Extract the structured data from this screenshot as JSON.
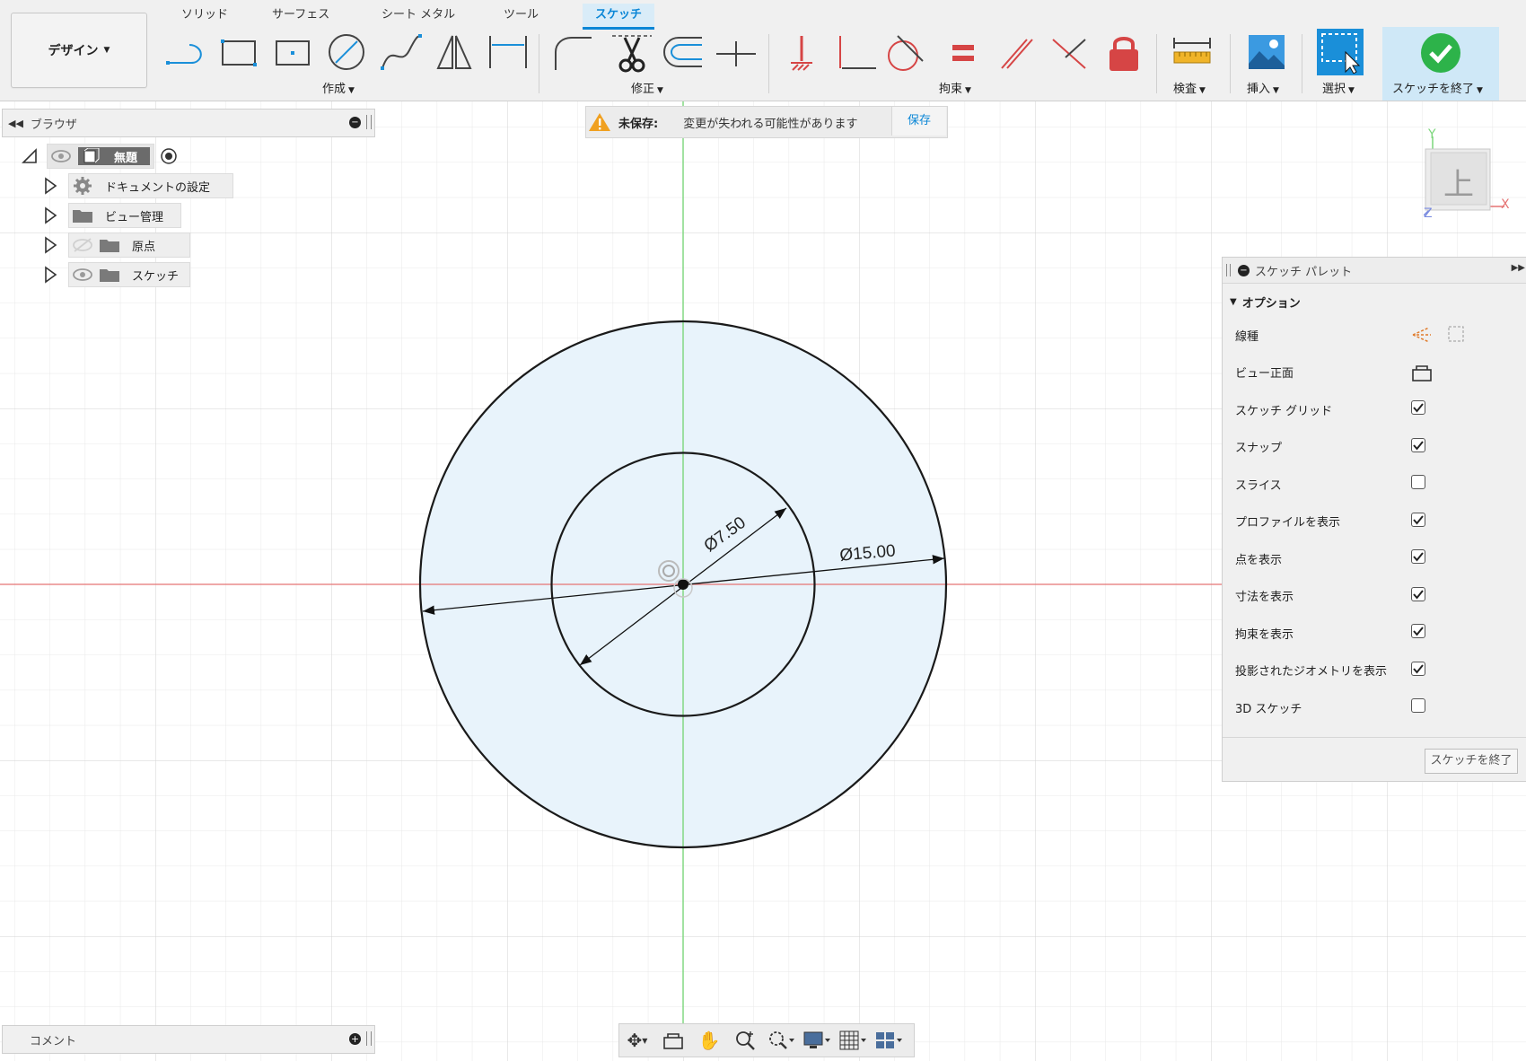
{
  "toolbar": {
    "workspace": "デザイン",
    "tabs": [
      "ソリッド",
      "サーフェス",
      "シート メタル",
      "ツール",
      "スケッチ"
    ],
    "active_tab": "スケッチ",
    "groups": {
      "create": "作成",
      "modify": "修正",
      "constraints": "拘束",
      "inspect": "検査",
      "insert": "挿入",
      "select": "選択",
      "finish": "スケッチを終了"
    }
  },
  "browser": {
    "title": "ブラウザ",
    "root": "無題",
    "items": [
      "ドキュメントの設定",
      "ビュー管理",
      "原点",
      "スケッチ"
    ]
  },
  "unsaved": {
    "label": "未保存:",
    "message": "変更が失われる可能性があります",
    "save": "保存"
  },
  "palette": {
    "title": "スケッチ パレット",
    "section": "オプション",
    "rows": [
      {
        "label": "線種",
        "control": "linetype"
      },
      {
        "label": "ビュー正面",
        "control": "view"
      },
      {
        "label": "スケッチ グリッド",
        "checked": true
      },
      {
        "label": "スナップ",
        "checked": true
      },
      {
        "label": "スライス",
        "checked": false
      },
      {
        "label": "プロファイルを表示",
        "checked": true
      },
      {
        "label": "点を表示",
        "checked": true
      },
      {
        "label": "寸法を表示",
        "checked": true
      },
      {
        "label": "拘束を表示",
        "checked": true
      },
      {
        "label": "投影されたジオメトリを表示",
        "checked": true
      },
      {
        "label": "3D スケッチ",
        "checked": false
      }
    ],
    "finish_button": "スケッチを終了"
  },
  "canvas": {
    "dimension_inner": "Ø7.50",
    "dimension_outer": "Ø15.00",
    "axis_colors": {
      "x": "#e57373",
      "y": "#7bd67b",
      "profile_fill": "#e8f3fb"
    }
  },
  "viewcube": {
    "face": "上",
    "x": "X",
    "y": "Y",
    "z": "Z"
  },
  "comments": {
    "title": "コメント"
  },
  "colors": {
    "accent": "#0a86d6",
    "finish_green": "#2db34a",
    "warning": "#f0a020",
    "lock_red": "#d64545"
  }
}
